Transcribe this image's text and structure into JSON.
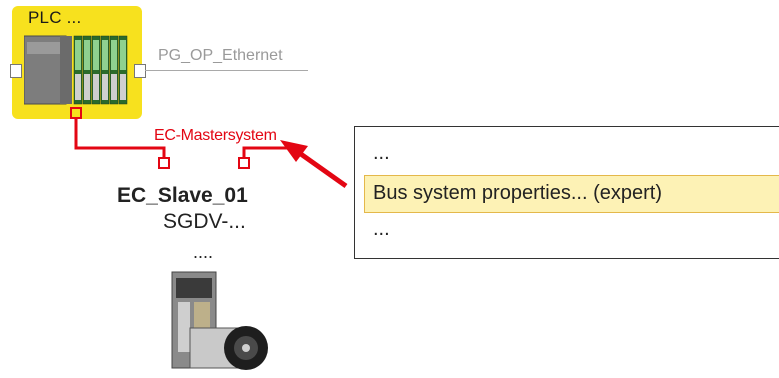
{
  "plc": {
    "label": "PLC ..."
  },
  "network": {
    "label": "PG_OP_Ethernet"
  },
  "master": {
    "label": "EC-Mastersystem"
  },
  "slave": {
    "name": "EC_Slave_01",
    "type": "SGDV-...",
    "more": "...."
  },
  "context_menu": {
    "items": [
      {
        "label": "...",
        "highlighted": false
      },
      {
        "label": "Bus system properties... (expert)",
        "highlighted": true
      },
      {
        "label": "...",
        "highlighted": false
      }
    ]
  },
  "colors": {
    "plc_background": "#f7e11e",
    "bus_line": "#e30613",
    "ethernet_line": "#a9a9a9",
    "highlight_fill": "#fdf2b5",
    "highlight_border": "#e4b84a"
  },
  "icons": [
    "plc-module-icon",
    "servo-drive-icon",
    "pointer-arrow-icon"
  ]
}
